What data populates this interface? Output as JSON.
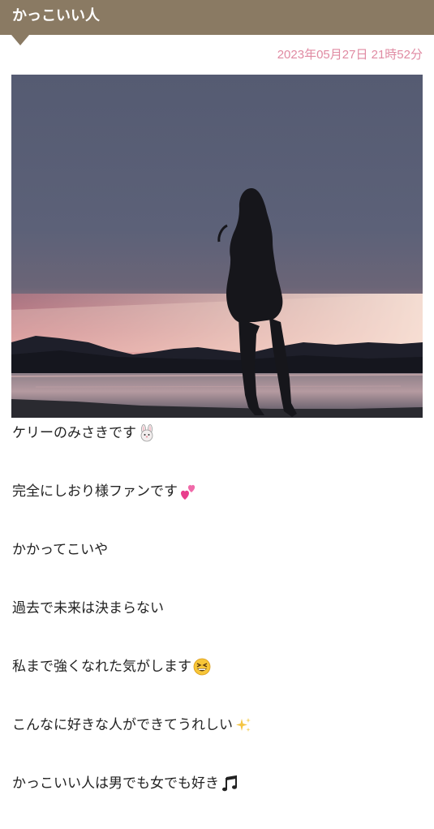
{
  "header": {
    "title": "かっこいい人"
  },
  "post": {
    "date": "2023年05月27日 21時52分",
    "image": {
      "subject": "silhouette of a woman standing by a lake at sunset, mountains in background"
    },
    "lines": [
      {
        "text": "ケリーのみさきです",
        "icon": "rabbit-face-icon"
      },
      {
        "text": "完全にしおり様ファンです",
        "icon": "two-hearts-icon"
      },
      {
        "text": "かかってこいや",
        "icon": ""
      },
      {
        "text": "過去で未来は決まらない",
        "icon": ""
      },
      {
        "text": "私まで強くなれた気がします",
        "icon": "grinning-squinting-face-icon"
      },
      {
        "text": "こんなに好きな人ができてうれしい",
        "icon": "sparkles-icon"
      },
      {
        "text": "かっこいい人は男でも女でも好き",
        "icon": "musical-note-icon"
      }
    ]
  },
  "colors": {
    "header_bg": "#8a7a63",
    "header_text": "#ffffff",
    "date_text": "#e08aa2",
    "body_text": "#222222"
  }
}
